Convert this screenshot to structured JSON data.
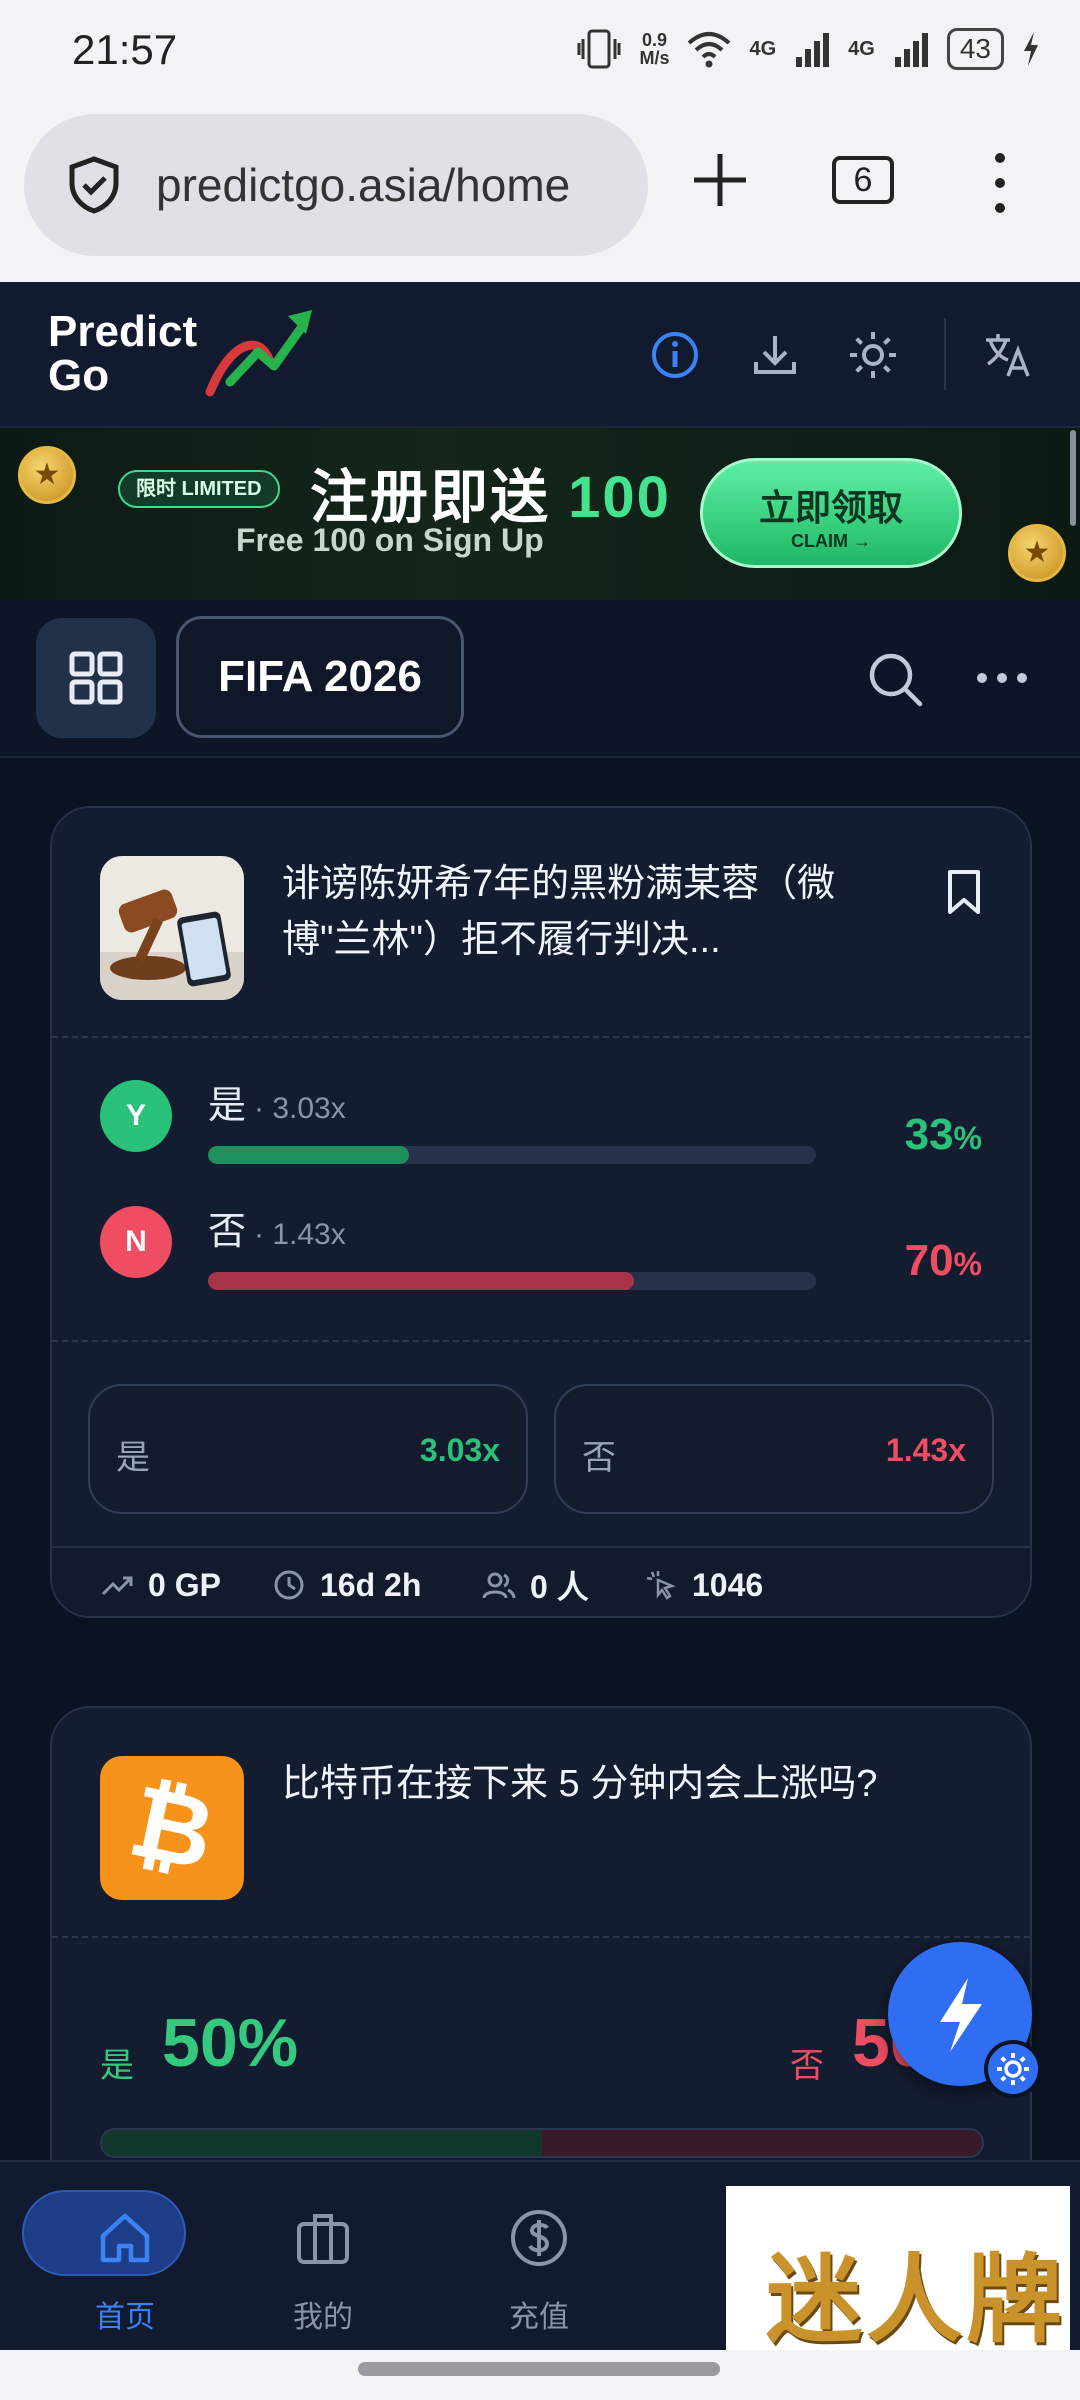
{
  "status_bar": {
    "time": "21:57",
    "net_speed_value": "0.9",
    "net_speed_unit": "M/s",
    "network_1": "4G",
    "network_2": "4G",
    "battery": "43",
    "icons": [
      "vibrate-icon",
      "wifi-icon",
      "signal-icon",
      "signal-icon",
      "battery-icon",
      "charging-icon"
    ]
  },
  "browser": {
    "url": "predictgo.asia/home",
    "tab_count": "6",
    "icons": [
      "shield-icon",
      "plus-icon",
      "tabs-icon",
      "more-vert-icon"
    ]
  },
  "app_header": {
    "logo_line1": "Predict",
    "logo_line2": "Go",
    "icons": [
      "info-icon",
      "download-icon",
      "sun-icon",
      "translate-icon"
    ],
    "accent": "#3b82f6"
  },
  "promo": {
    "tag": "限时 LIMITED",
    "headline": "注册即送",
    "amount": "100",
    "subline": "Free 100 on Sign Up",
    "cta_main": "立即领取",
    "cta_sub": "CLAIM →",
    "coin_glyph": "★"
  },
  "category_bar": {
    "active_chip": "FIFA 2026",
    "icons": [
      "grid-icon",
      "search-icon",
      "more-horiz-icon"
    ]
  },
  "market_1": {
    "title": "诽谤陈妍希7年的黑粉满某蓉（微博\"兰林\"）拒不履行判决...",
    "options": [
      {
        "badge": "Y",
        "label": "是",
        "multiplier": "· 3.03x",
        "percent": "33",
        "symbol": "%",
        "fill": 0.33,
        "color": "#2ac27a"
      },
      {
        "badge": "N",
        "label": "否",
        "multiplier": "· 1.43x",
        "percent": "70",
        "symbol": "%",
        "fill": 0.7,
        "color": "#ef4d62"
      }
    ],
    "bet_buttons": [
      {
        "label": "是",
        "value": "3.03x"
      },
      {
        "label": "否",
        "value": "1.43x"
      }
    ],
    "stats": {
      "volume": "0 GP",
      "time_left": "16d 2h",
      "participants": "0 人",
      "clicks": "1046"
    }
  },
  "market_2": {
    "title": "比特币在接下来 5 分钟内会上涨吗?",
    "icon_glyph": "₿",
    "yes_label": "是",
    "yes_percent": "50%",
    "no_label": "否",
    "no_percent": "50%",
    "yes_share": 0.5
  },
  "fab": {
    "icons": [
      "lightning-icon",
      "gear-icon"
    ]
  },
  "bottom_nav": {
    "items": [
      {
        "label": "首页",
        "icon": "home-icon",
        "active": true
      },
      {
        "label": "我的",
        "icon": "briefcase-icon",
        "active": false
      },
      {
        "label": "充值",
        "icon": "dollar-icon",
        "active": false
      }
    ]
  },
  "overlay_brand": "迷人牌",
  "colors": {
    "yes": "#2ac27a",
    "no": "#ef4d62",
    "bg": "#0b1222",
    "card": "#141c2f",
    "active_nav": "#3b82f6"
  }
}
